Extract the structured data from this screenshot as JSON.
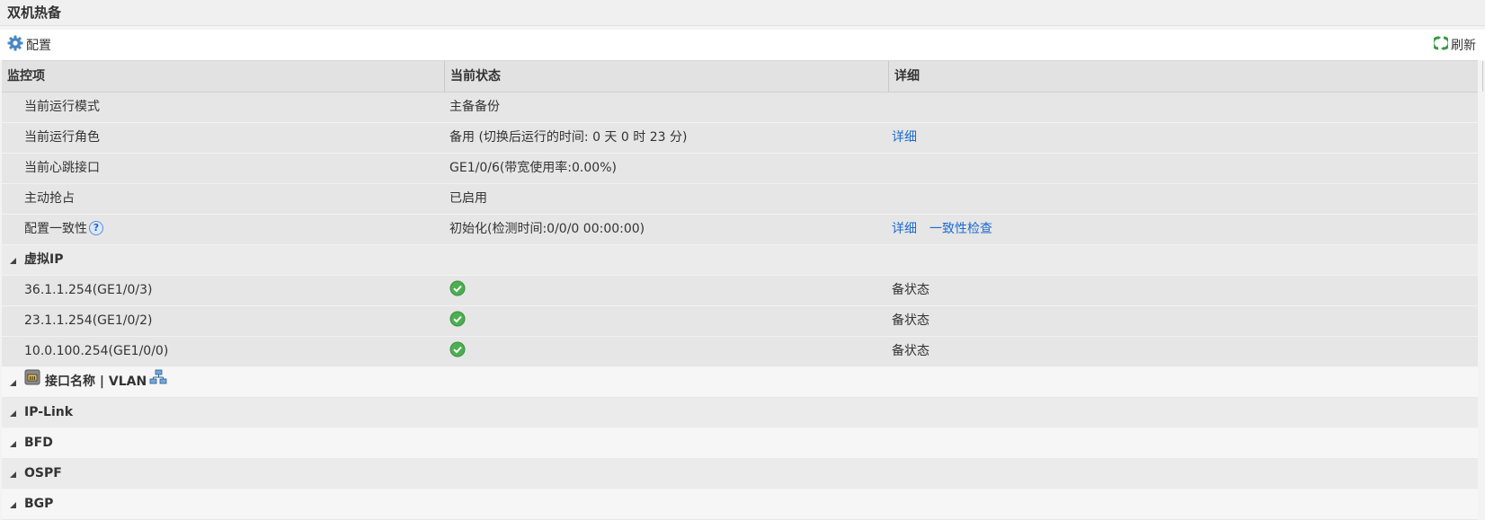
{
  "window": {
    "title": "双机热备"
  },
  "toolbar": {
    "config_label": "配置",
    "refresh_label": "刷新"
  },
  "table": {
    "headers": [
      "监控项",
      "当前状态",
      "详细"
    ],
    "rows": [
      {
        "item": "当前运行模式",
        "status": "主备备份"
      },
      {
        "item": "当前运行角色",
        "status": "备用 (切换后运行的时间: 0 天 0 时 23 分)",
        "link": "详细"
      },
      {
        "item": "当前心跳接口",
        "status": "GE1/0/6(带宽使用率:0.00%)"
      },
      {
        "item": "主动抢占",
        "status": "已启用"
      },
      {
        "item": "配置一致性",
        "help": "?",
        "status": "初始化(检测时间:0/0/0 00:00:00)",
        "link": "详细",
        "link2": "一致性检查"
      }
    ],
    "groups": {
      "virtual_ip": {
        "name": "虚拟IP",
        "rows": [
          {
            "ip": "36.1.1.254(GE1/0/3)",
            "state": "ok",
            "detail": "备状态"
          },
          {
            "ip": "23.1.1.254(GE1/0/2)",
            "state": "ok",
            "detail": "备状态"
          },
          {
            "ip": "10.0.100.254(GE1/0/0)",
            "state": "ok",
            "detail": "备状态"
          }
        ]
      },
      "interface": {
        "name": "接口名称 | VLAN"
      },
      "iplink": {
        "name": "IP-Link"
      },
      "bfd": {
        "name": "BFD"
      },
      "ospf": {
        "name": "OSPF"
      },
      "bgp": {
        "name": "BGP"
      }
    }
  },
  "colors": {
    "link": "#1c6bd0",
    "ok": "#4caf50"
  }
}
